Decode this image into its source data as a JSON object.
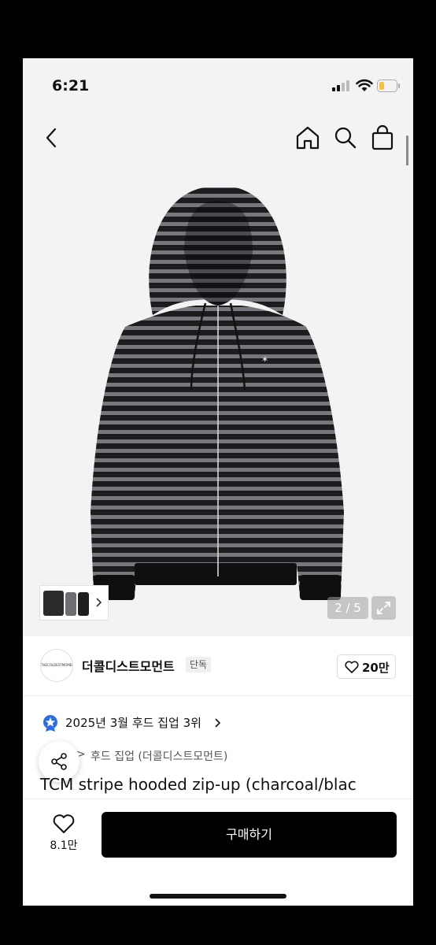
{
  "status_bar": {
    "time": "6:21"
  },
  "product_gallery": {
    "counter": "2 / 5"
  },
  "brand": {
    "name": "더콜디스트모먼트",
    "badge": "단독",
    "logo_text": "THECOLDESTMOMENT",
    "likes": "20만"
  },
  "ranking": {
    "text": "2025년 3월 후드 집업 3위"
  },
  "category": {
    "chevron": ">",
    "text": "후드 집업 (더콜디스트모먼트)"
  },
  "product": {
    "title": "TCM stripe hooded zip-up (charcoal/blac"
  },
  "bottom_bar": {
    "wish_count": "8.1만",
    "buy_label": "구매하기"
  },
  "icons": [
    "back-icon",
    "home-icon",
    "search-icon",
    "bag-icon",
    "heart-icon",
    "share-icon",
    "expand-icon",
    "medal-icon",
    "chevron-right-icon"
  ]
}
